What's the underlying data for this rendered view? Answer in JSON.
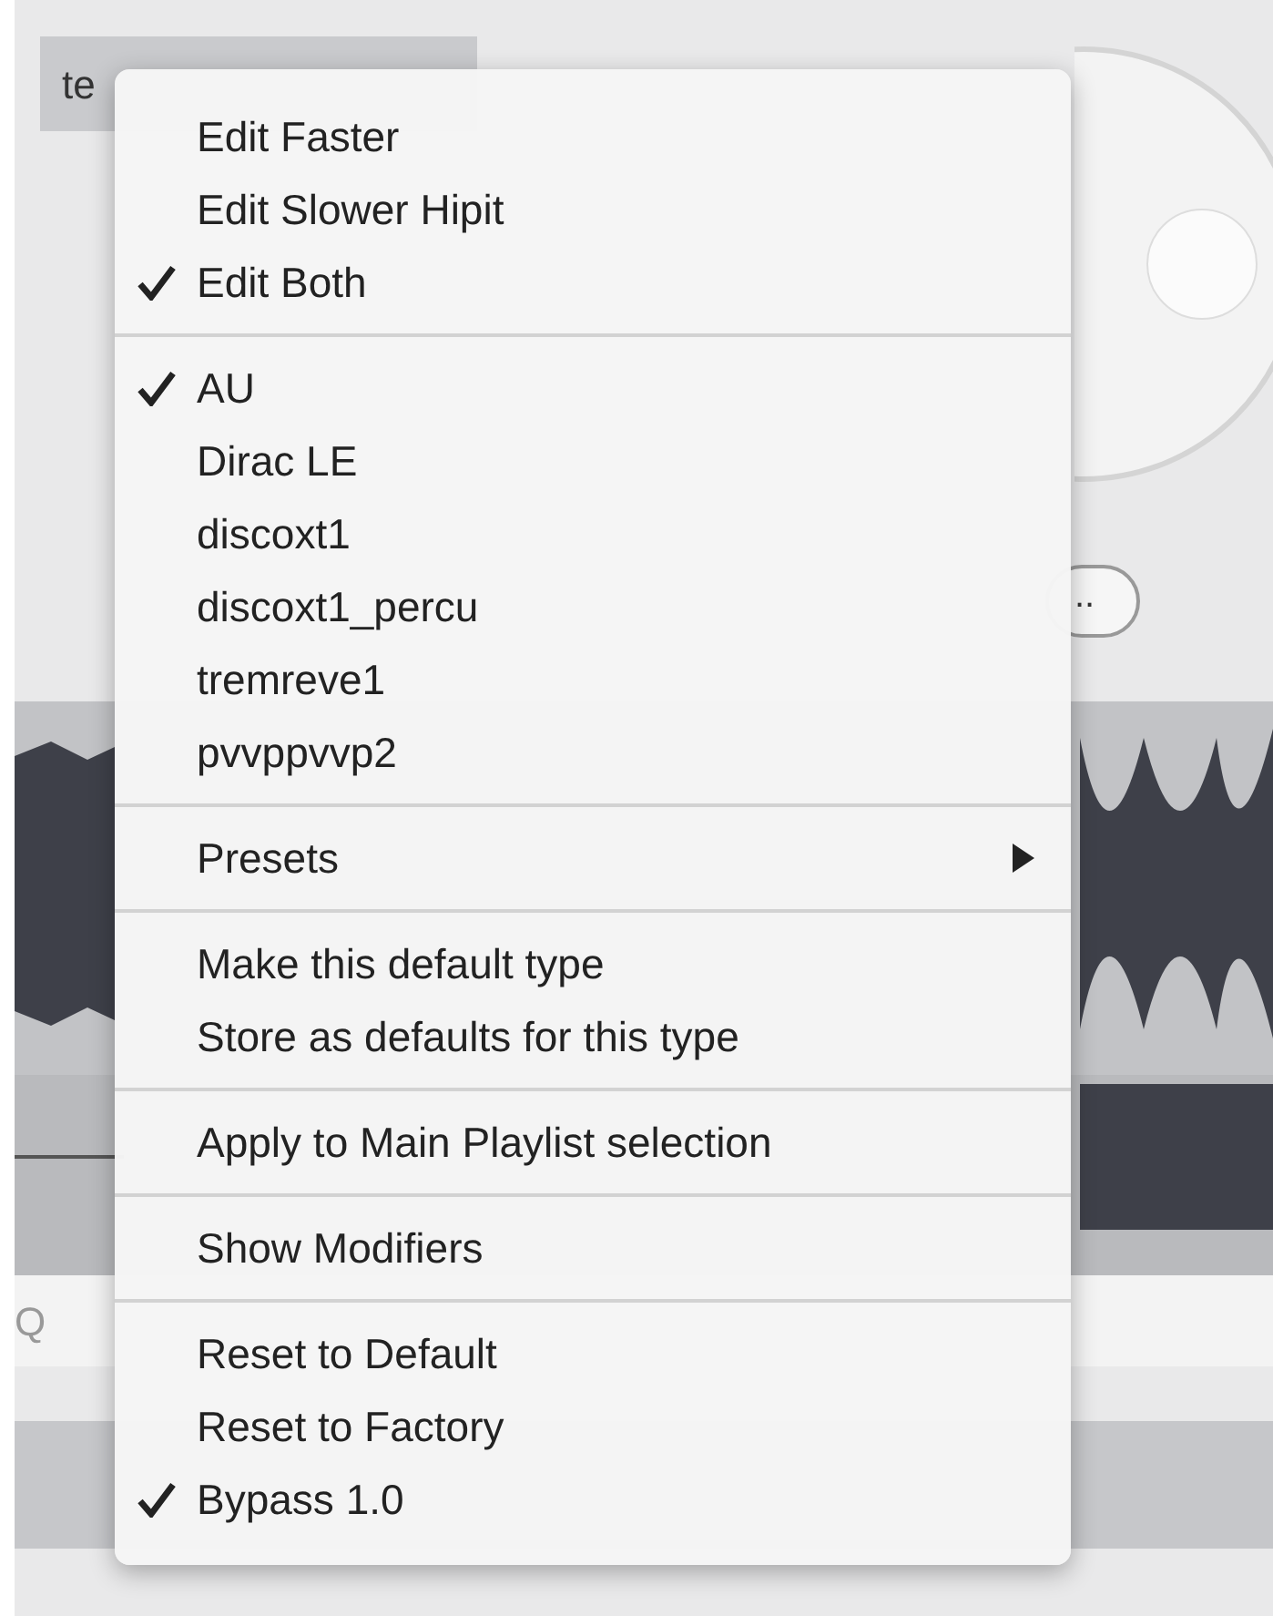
{
  "background": {
    "track_label": "te",
    "more_button": "..",
    "field_label": "Q"
  },
  "menu": {
    "sections": [
      {
        "items": [
          {
            "label": "Edit Faster",
            "checked": false,
            "kind": "command"
          },
          {
            "label": "Edit Slower Hipit",
            "checked": false,
            "kind": "command"
          },
          {
            "label": "Edit Both",
            "checked": true,
            "kind": "command"
          }
        ]
      },
      {
        "items": [
          {
            "label": "AU",
            "checked": true,
            "kind": "command"
          },
          {
            "label": "Dirac LE",
            "checked": false,
            "kind": "command"
          },
          {
            "label": "discoxt1",
            "checked": false,
            "kind": "command"
          },
          {
            "label": "discoxt1_percu",
            "checked": false,
            "kind": "command"
          },
          {
            "label": "tremreve1",
            "checked": false,
            "kind": "command"
          },
          {
            "label": "pvvppvvp2",
            "checked": false,
            "kind": "command"
          }
        ]
      },
      {
        "items": [
          {
            "label": "Presets",
            "checked": false,
            "kind": "submenu"
          }
        ]
      },
      {
        "items": [
          {
            "label": "Make this default type",
            "checked": false,
            "kind": "command"
          },
          {
            "label": "Store as defaults for this type",
            "checked": false,
            "kind": "command"
          }
        ]
      },
      {
        "items": [
          {
            "label": "Apply to Main Playlist selection",
            "checked": false,
            "kind": "command"
          }
        ]
      },
      {
        "items": [
          {
            "label": "Show Modifiers",
            "checked": false,
            "kind": "command"
          }
        ]
      },
      {
        "items": [
          {
            "label": "Reset to Default",
            "checked": false,
            "kind": "command"
          },
          {
            "label": "Reset to Factory",
            "checked": false,
            "kind": "command"
          },
          {
            "label": "Bypass 1.0",
            "checked": true,
            "kind": "command"
          }
        ]
      }
    ]
  }
}
